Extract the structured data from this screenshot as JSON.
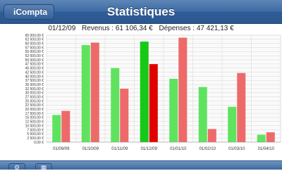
{
  "nav": {
    "back_label": "iCompta",
    "title": "Statistiques"
  },
  "summary": {
    "date": "01/12/09",
    "revenus": "Revenus : 61 106,34 €",
    "depenses": "Dépenses : 47 421,13 €"
  },
  "toolbar": {
    "buttons": [
      {
        "icon": "gear-icon"
      },
      {
        "icon": "calendar-icon"
      }
    ]
  },
  "colors": {
    "revenus": "#5fe35f",
    "depenses": "#ee6a6a",
    "revenus_selected": "#16c916",
    "depenses_selected": "#e00000"
  },
  "chart_data": {
    "type": "bar",
    "categories": [
      "01/09/09",
      "01/10/09",
      "01/11/09",
      "01/12/09",
      "01/01/10",
      "01/02/10",
      "01/03/10",
      "01/04/10"
    ],
    "series": [
      {
        "values": [
          16500,
          59000,
          45000,
          61106.34,
          38500,
          33500,
          21500,
          4500
        ]
      },
      {
        "values": [
          19000,
          60500,
          32500,
          47421.13,
          63500,
          8000,
          42000,
          6000
        ]
      }
    ],
    "selected_index": 3,
    "y_ticks": [
      "0,00 €",
      "2 500,00 €",
      "5 000,00 €",
      "7 500,00 €",
      "10 000,00 €",
      "12 500,00 €",
      "15 000,00 €",
      "17 500,00 €",
      "20 000,00 €",
      "22 500,00 €",
      "25 000,00 €",
      "27 500,00 €",
      "30 000,00 €",
      "32 500,00 €",
      "35 000,00 €",
      "37 500,00 €",
      "40 000,00 €",
      "42 500,00 €",
      "45 000,00 €",
      "47 500,00 €",
      "50 000,00 €",
      "52 500,00 €",
      "55 000,00 €",
      "57 500,00 €",
      "60 000,00 €",
      "62 500,00 €",
      "65 000,00 €"
    ],
    "ylim": [
      0,
      65000
    ],
    "grid": true
  }
}
